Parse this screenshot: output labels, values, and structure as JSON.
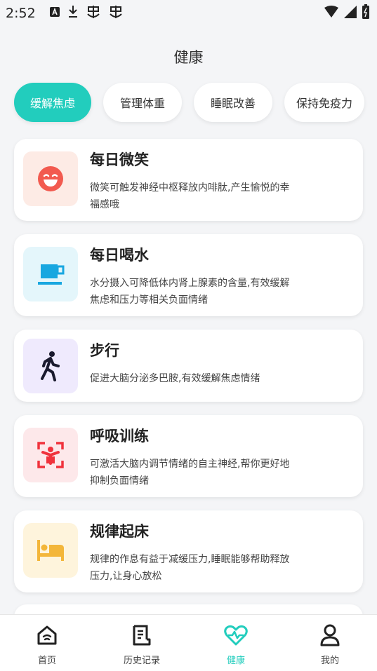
{
  "status_bar": {
    "time": "2:52"
  },
  "page_title": "健康",
  "tabs": [
    {
      "label": "缓解焦虑",
      "active": true
    },
    {
      "label": "管理体重",
      "active": false
    },
    {
      "label": "睡眠改善",
      "active": false
    },
    {
      "label": "保持免疫力",
      "active": false
    }
  ],
  "cards": [
    {
      "title": "每日微笑",
      "desc_line1": "微笑可触发神经中枢释放内啡肽,产生愉悦的幸",
      "desc_line2": "福感哦",
      "icon": "smile-icon",
      "icon_bg": "#fdebe5",
      "icon_color": "#f25a4f"
    },
    {
      "title": "每日喝水",
      "desc_line1": "水分摄入可降低体内肾上腺素的含量,有效缓解",
      "desc_line2": "焦虑和压力等相关负面情绪",
      "icon": "cup-icon",
      "icon_bg": "#e4f6fb",
      "icon_color": "#18a7e0"
    },
    {
      "title": "步行",
      "desc_line1": "促进大脑分泌多巴胺,有效缓解焦虑情绪",
      "desc_line2": "",
      "icon": "walk-icon",
      "icon_bg": "#efeafd",
      "icon_color": "#1a1a2e"
    },
    {
      "title": "呼吸训练",
      "desc_line1": "可激活大脑内调节情绪的自主神经,帮你更好地",
      "desc_line2": "抑制负面情绪",
      "icon": "breath-icon",
      "icon_bg": "#fde8ea",
      "icon_color": "#f0323c"
    },
    {
      "title": "规律起床",
      "desc_line1": "规律的作息有益于减缓压力,睡眠能够帮助释放",
      "desc_line2": "压力,让身心放松",
      "icon": "bed-icon",
      "icon_bg": "#fef4dc",
      "icon_color": "#f3b63a"
    }
  ],
  "bottom_nav": [
    {
      "label": "首页",
      "icon": "home-icon",
      "active": false
    },
    {
      "label": "历史记录",
      "icon": "history-icon",
      "active": false
    },
    {
      "label": "健康",
      "icon": "heart-pulse-icon",
      "active": true
    },
    {
      "label": "我的",
      "icon": "profile-icon",
      "active": false
    }
  ],
  "colors": {
    "accent": "#22cdbd",
    "background": "#f4f5f7"
  }
}
